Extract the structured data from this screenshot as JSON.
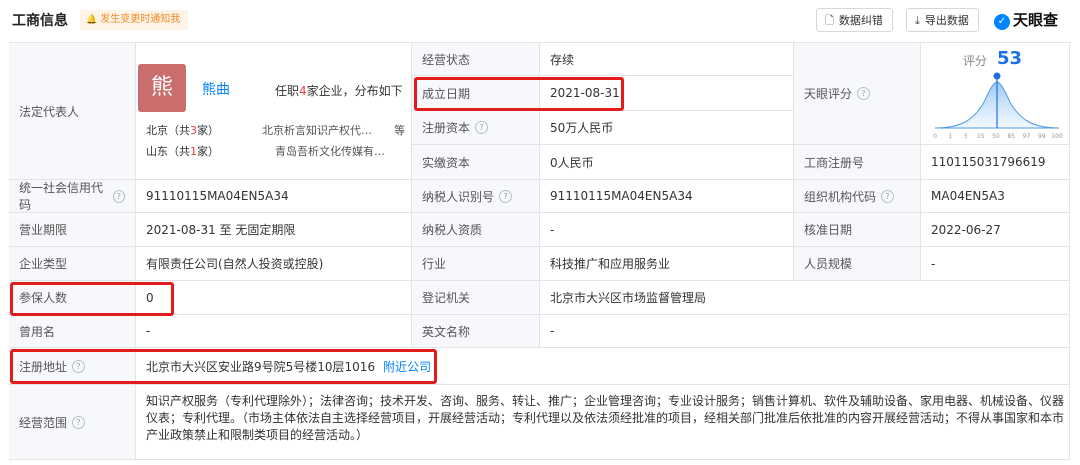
{
  "header": {
    "title": "工商信息",
    "notice": "发生变更时通知我",
    "btn_correction": "数据纠错",
    "btn_export": "导出数据",
    "logo": "天眼查"
  },
  "legal": {
    "label": "法定代表人",
    "avatar_char": "熊",
    "name": "熊曲",
    "desc_pre": "任职",
    "desc_num": "4",
    "desc_post": "家企业，分布如下",
    "loc1_name": "北京（共",
    "loc1_num": "3",
    "loc1_unit": "家）",
    "loc1_company": "北京析言知识产权代…",
    "loc1_more": "等",
    "loc2_name": "山东（共",
    "loc2_num": "1",
    "loc2_unit": "家）",
    "loc2_company": "青岛吾析文化传媒有…"
  },
  "rows": {
    "status_label": "经营状态",
    "status_value": "存续",
    "found_label": "成立日期",
    "found_value": "2021-08-31",
    "reg_cap_label": "注册资本",
    "reg_cap_value": "50万人民币",
    "paid_cap_label": "实缴资本",
    "paid_cap_value": "0人民币",
    "score_label": "天眼评分",
    "score_word": "评分",
    "score_value": "53",
    "reg_no_label": "工商注册号",
    "reg_no_value": "110115031796619",
    "credit_label": "统一社会信用代码",
    "credit_value": "91110115MA04EN5A34",
    "taxid_label": "纳税人识别号",
    "taxid_value": "91110115MA04EN5A34",
    "org_label": "组织机构代码",
    "org_value": "MA04EN5A3",
    "term_label": "营业期限",
    "term_value": "2021-08-31 至 无固定期限",
    "taxq_label": "纳税人资质",
    "taxq_value": "-",
    "approve_label": "核准日期",
    "approve_value": "2022-06-27",
    "type_label": "企业类型",
    "type_value": "有限责任公司(自然人投资或控股)",
    "industry_label": "行业",
    "industry_value": "科技推广和应用服务业",
    "staff_label": "人员规模",
    "staff_value": "-",
    "insured_label": "参保人数",
    "insured_value": "0",
    "authority_label": "登记机关",
    "authority_value": "北京市大兴区市场监督管理局",
    "former_label": "曾用名",
    "former_value": "-",
    "english_label": "英文名称",
    "english_value": "-",
    "address_label": "注册地址",
    "address_value": "北京市大兴区安业路9号院5号楼10层1016",
    "address_link": "附近公司",
    "scope_label": "经营范围",
    "scope_value": "知识产权服务（专利代理除外）；法律咨询；技术开发、咨询、服务、转让、推广；企业管理咨询；专业设计服务；销售计算机、软件及辅助设备、家用电器、机械设备、仪器仪表；专利代理。（市场主体依法自主选择经营项目，开展经营活动；专利代理以及依法须经批准的项目，经相关部门批准后依批准的内容开展经营活动；不得从事国家和本市产业政策禁止和限制类项目的经营活动。）"
  },
  "score_chart": {
    "ticks": [
      "0",
      "1",
      "3",
      "15",
      "50",
      "85",
      "97",
      "99",
      "100"
    ],
    "marker": 53
  },
  "colors": {
    "accent": "#0084ff",
    "highlight": "#e21b1b",
    "label_bg": "#f6f8fb",
    "border": "#e4e4e4",
    "score": "#1e6fe6"
  }
}
